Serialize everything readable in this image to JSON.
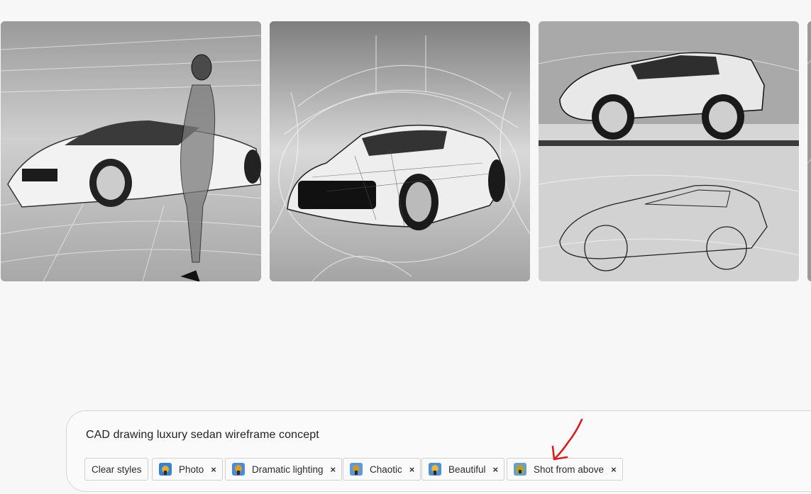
{
  "gallery": {
    "images": [
      {
        "name": "generated-image-1",
        "alt": "wireframe sedan with figure"
      },
      {
        "name": "generated-image-2",
        "alt": "wireframe sports car"
      },
      {
        "name": "generated-image-3",
        "alt": "wireframe SUV split view"
      },
      {
        "name": "generated-image-4",
        "alt": "partial image"
      }
    ]
  },
  "prompt": {
    "text": "CAD drawing luxury sedan wireframe concept",
    "clear_label": "Clear styles",
    "remove_glyph": "×",
    "styles": [
      {
        "label": "Photo",
        "icon": "style-thumbnail-icon"
      },
      {
        "label": "Dramatic lighting",
        "icon": "style-thumbnail-icon"
      },
      {
        "label": "Chaotic",
        "icon": "style-thumbnail-icon"
      },
      {
        "label": "Beautiful",
        "icon": "style-thumbnail-icon"
      },
      {
        "label": "Shot from above",
        "icon": "style-thumbnail-icon"
      }
    ]
  },
  "colors": {
    "annotation": "#d42020",
    "border": "#d6d6d6"
  }
}
